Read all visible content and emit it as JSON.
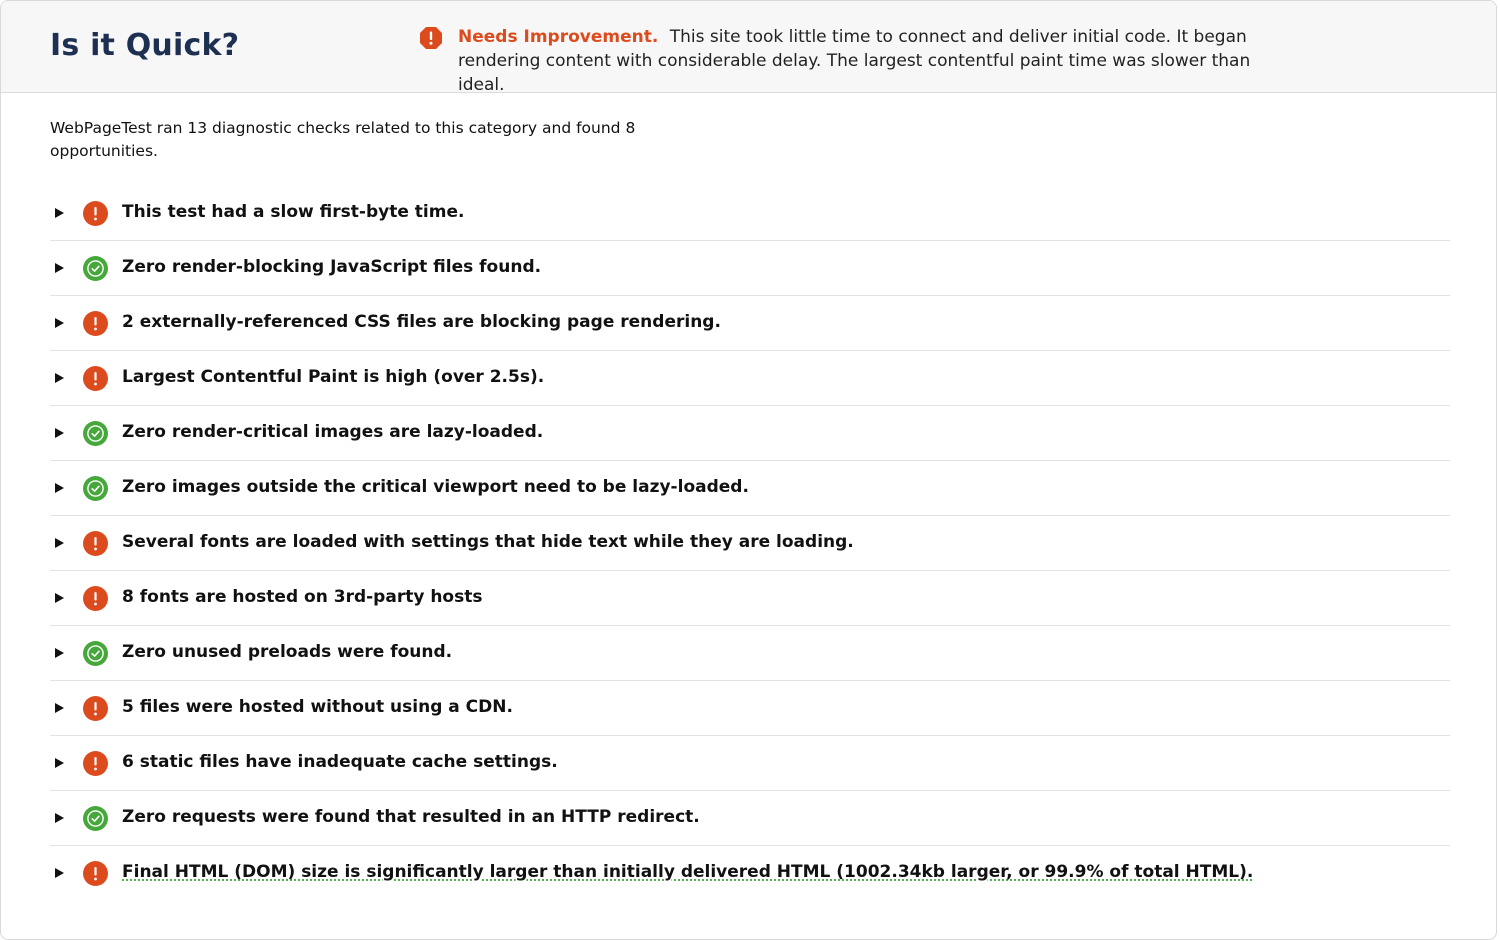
{
  "header": {
    "title": "Is it Quick?",
    "verdict_label": "Needs Improvement.",
    "verdict_text": "This site took little time to connect and deliver initial code. It began rendering content with considerable delay. The largest contentful paint time was slower than ideal.",
    "verdict_icon": "warning-octagon-icon"
  },
  "summary": "WebPageTest ran 13 diagnostic checks related to this category and found 8 opportunities.",
  "colors": {
    "warning": "#dc4b1d",
    "pass": "#46a83b",
    "title": "#1e3052"
  },
  "checks": [
    {
      "status": "warning",
      "label": "This test had a slow first-byte time."
    },
    {
      "status": "pass",
      "label": "Zero render-blocking JavaScript files found."
    },
    {
      "status": "warning",
      "label": "2 externally-referenced CSS files are blocking page rendering."
    },
    {
      "status": "warning",
      "label": "Largest Contentful Paint is high (over 2.5s)."
    },
    {
      "status": "pass",
      "label": "Zero render-critical images are lazy-loaded."
    },
    {
      "status": "pass",
      "label": "Zero images outside the critical viewport need to be lazy-loaded."
    },
    {
      "status": "warning",
      "label": "Several fonts are loaded with settings that hide text while they are loading."
    },
    {
      "status": "warning",
      "label": "8 fonts are hosted on 3rd-party hosts"
    },
    {
      "status": "pass",
      "label": "Zero unused preloads were found."
    },
    {
      "status": "warning",
      "label": "5 files were hosted without using a CDN."
    },
    {
      "status": "warning",
      "label": "6 static files have inadequate cache settings."
    },
    {
      "status": "pass",
      "label": "Zero requests were found that resulted in an HTTP redirect."
    },
    {
      "status": "warning",
      "label": "Final HTML (DOM) size is significantly larger than initially delivered HTML (1002.34kb larger, or 99.9% of total HTML)."
    }
  ]
}
